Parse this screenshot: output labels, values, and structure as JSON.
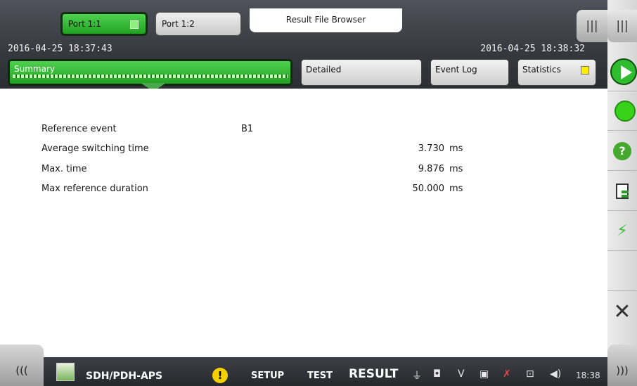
{
  "header": {
    "port_tabs": [
      {
        "label": "Port 1:1",
        "active": true,
        "indicator_color": "#8cf07a"
      },
      {
        "label": "Port 1:2",
        "active": false
      }
    ],
    "file_browser_label": "Result File Browser",
    "start_time": "2016-04-25 18:37:43",
    "end_time": "2016-04-25 18:38:32",
    "menu_icon": "menu-bars-icon"
  },
  "view_tabs": [
    {
      "label": "Summary",
      "active": true
    },
    {
      "label": "Detailed",
      "active": false
    },
    {
      "label": "Event Log",
      "active": false
    },
    {
      "label": "Statistics",
      "active": false,
      "indicator_color": "#ffee00"
    }
  ],
  "summary": {
    "reference_event_label": "Reference event",
    "reference_event_value": "B1",
    "rows": [
      {
        "label": "Average switching time",
        "value": "3.730",
        "unit": "ms"
      },
      {
        "label": "Max. time",
        "value": "9.876",
        "unit": "ms"
      },
      {
        "label": "Max reference duration",
        "value": "50.000",
        "unit": "ms"
      }
    ]
  },
  "sidebar": {
    "buttons": [
      "menu-bars-icon",
      "start-icon",
      "status-icon",
      "help-icon",
      "report-icon",
      "error-insert-icon",
      "close-icon"
    ],
    "help_glyph": "?"
  },
  "bottom_bar": {
    "app_name": "SDH/PDH-APS",
    "warning_glyph": "!",
    "setup_label": "SETUP",
    "test_label": "TEST",
    "result_label": "RESULT",
    "time": "18:38",
    "status_icons": [
      "power-icon",
      "storage-icon",
      "v-icon",
      "terminal-icon",
      "network-off-icon",
      "remote-icon",
      "volume-icon"
    ]
  },
  "colors": {
    "active_green": "#2fbd2f",
    "header_bg": "#35383e",
    "statistics_indicator": "#ffee00"
  }
}
